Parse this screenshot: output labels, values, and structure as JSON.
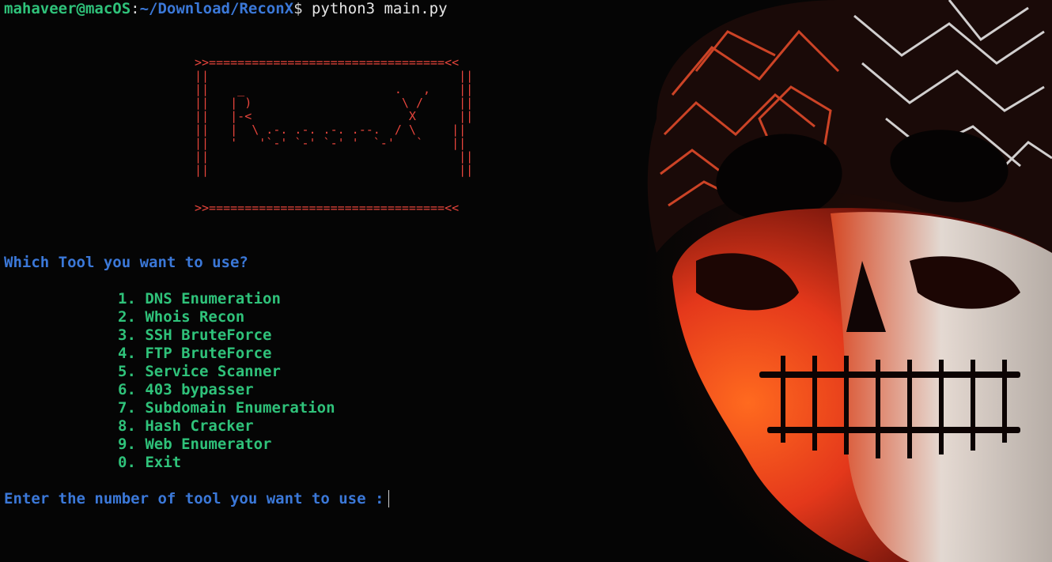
{
  "prompt": {
    "user_host": "mahaveer@macOS",
    "colon": ":",
    "path": "~/Download/ReconX",
    "dollar": "$",
    "command": " python3 main.py"
  },
  "banner": {
    "top_border": ">>=================================<<",
    "bottom_border": ">>=================================<<",
    "art": "||                                   ||\n||    _                     .   ,    ||\n||   | )                     \\ /     ||\n||   |-<                      X      ||\n||   |  \\ .-. .-. .-. .--.  / \\     ||\n||   '   '`-' `-' `-' '  `-'   `    ||\n||                                   ||\n||                                   ||",
    "title_text": "ReconX"
  },
  "question": "Which Tool you want to use?",
  "menu": [
    "1. DNS Enumeration",
    "2. Whois Recon",
    "3. SSH BruteForce",
    "4. FTP BruteForce",
    "5. Service Scanner",
    "6. 403 bypasser",
    "7. Subdomain Enumeration",
    "8. Hash Cracker",
    "9. Web Enumerator",
    "0. Exit"
  ],
  "input_prompt": "Enter the number of tool you want to use :",
  "background_image": "skull-mask-icon",
  "colors": {
    "background": "#050505",
    "green": "#2fc27a",
    "blue": "#3b78d8",
    "red": "#e8453c"
  }
}
